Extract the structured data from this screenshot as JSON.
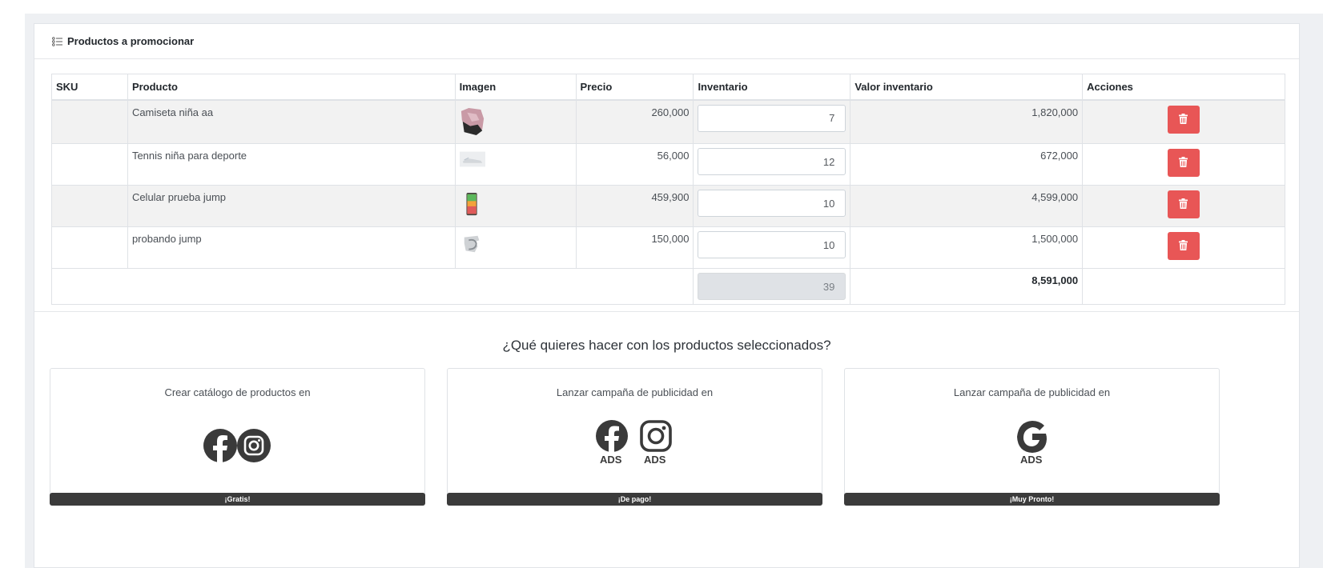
{
  "panel": {
    "title": "Productos a promocionar"
  },
  "table": {
    "headers": [
      "SKU",
      "Producto",
      "Imagen",
      "Precio",
      "Inventario",
      "Valor inventario",
      "Acciones"
    ],
    "rows": [
      {
        "sku": "",
        "product": "Camiseta niña aa",
        "image": "shirt-thumbnail",
        "price": "260,000",
        "inventory": "7",
        "value": "1,820,000"
      },
      {
        "sku": "",
        "product": "Tennis niña para deporte",
        "image": "shoe-thumbnail",
        "price": "56,000",
        "inventory": "12",
        "value": "672,000"
      },
      {
        "sku": "",
        "product": "Celular prueba jump",
        "image": "phone-thumbnail",
        "price": "459,900",
        "inventory": "10",
        "value": "4,599,000"
      },
      {
        "sku": "",
        "product": "probando jump",
        "image": "product-thumbnail",
        "price": "150,000",
        "inventory": "10",
        "value": "1,500,000"
      }
    ],
    "totals": {
      "inventory": "39",
      "value": "8,591,000"
    }
  },
  "question": "¿Qué quieres hacer con los productos seleccionados?",
  "cards": [
    {
      "title": "Crear catálogo de productos en",
      "badge": "¡Gratis!",
      "icons": [
        "facebook-icon",
        "instagram-icon"
      ]
    },
    {
      "title": "Lanzar campaña de publicidad en",
      "badge": "¡De pago!",
      "icons": [
        "facebook-icon",
        "instagram-icon"
      ],
      "labels": [
        "ADS",
        "ADS"
      ]
    },
    {
      "title": "Lanzar campaña de publicidad en",
      "badge": "¡Muy Pronto!",
      "icons": [
        "google-icon"
      ],
      "labels": [
        "ADS"
      ]
    }
  ],
  "colors": {
    "delete": "#e85656",
    "badge": "#3b3b3b",
    "icon": "#3a3a3a"
  }
}
